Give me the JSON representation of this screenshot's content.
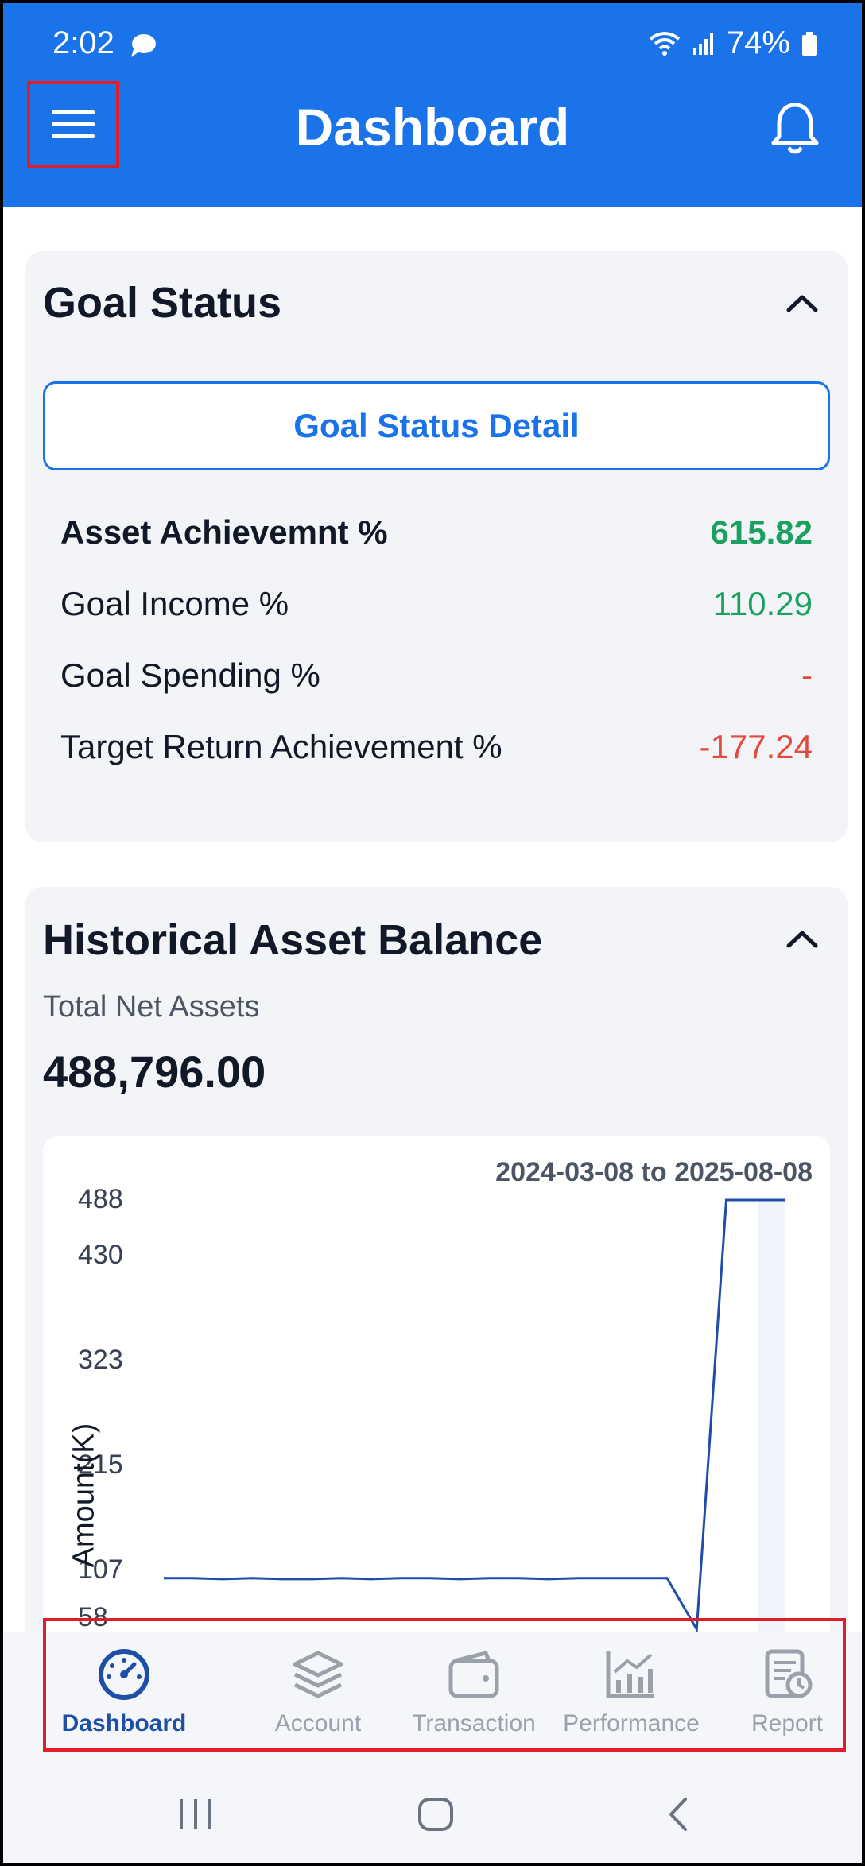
{
  "status_bar": {
    "time": "2:02",
    "battery": "74%"
  },
  "header": {
    "title": "Dashboard"
  },
  "goal_status": {
    "title": "Goal Status",
    "detail_button": "Goal Status Detail",
    "metrics": [
      {
        "label": "Asset Achievemnt %",
        "value": "615.82",
        "status": "positive",
        "emphasis": true
      },
      {
        "label": "Goal Income %",
        "value": "110.29",
        "status": "positive",
        "emphasis": false
      },
      {
        "label": "Goal Spending %",
        "value": "-",
        "status": "negative",
        "emphasis": false
      },
      {
        "label": "Target Return Achievement %",
        "value": "-177.24",
        "status": "negative",
        "emphasis": false
      }
    ]
  },
  "historical": {
    "title": "Historical Asset Balance",
    "total_label": "Total Net Assets",
    "total_value": "488,796.00",
    "date_range": "2024-03-08 to 2025-08-08"
  },
  "chart_data": {
    "type": "line",
    "ylabel": "Amount(K)",
    "yticks": [
      "488",
      "430",
      "323",
      "215",
      "107",
      "58"
    ],
    "ytick_values": [
      488,
      430,
      323,
      215,
      107,
      58
    ],
    "ylim": [
      0,
      488
    ],
    "x_start": "2024-03-08",
    "x_end": "2025-08-08",
    "series": [
      {
        "values": [
          58,
          58,
          57,
          58,
          57,
          57,
          58,
          57,
          58,
          58,
          57,
          58,
          58,
          57,
          58,
          58,
          58,
          58,
          0,
          488,
          488,
          488
        ]
      }
    ],
    "color": "#1e4fa8"
  },
  "bottom_nav": {
    "items": [
      {
        "label": "Dashboard",
        "icon": "speedometer-icon",
        "active": true
      },
      {
        "label": "Account",
        "icon": "layers-icon",
        "active": false
      },
      {
        "label": "Transaction",
        "icon": "wallet-icon",
        "active": false
      },
      {
        "label": "Performance",
        "icon": "chart-icon",
        "active": false
      },
      {
        "label": "Report",
        "icon": "report-icon",
        "active": false
      }
    ]
  },
  "colors": {
    "primary": "#1a73e8",
    "positive": "#1aa15f",
    "negative": "#e5483f",
    "nav_active": "#1e4fa8",
    "nav_inactive": "#9aa1ab"
  }
}
